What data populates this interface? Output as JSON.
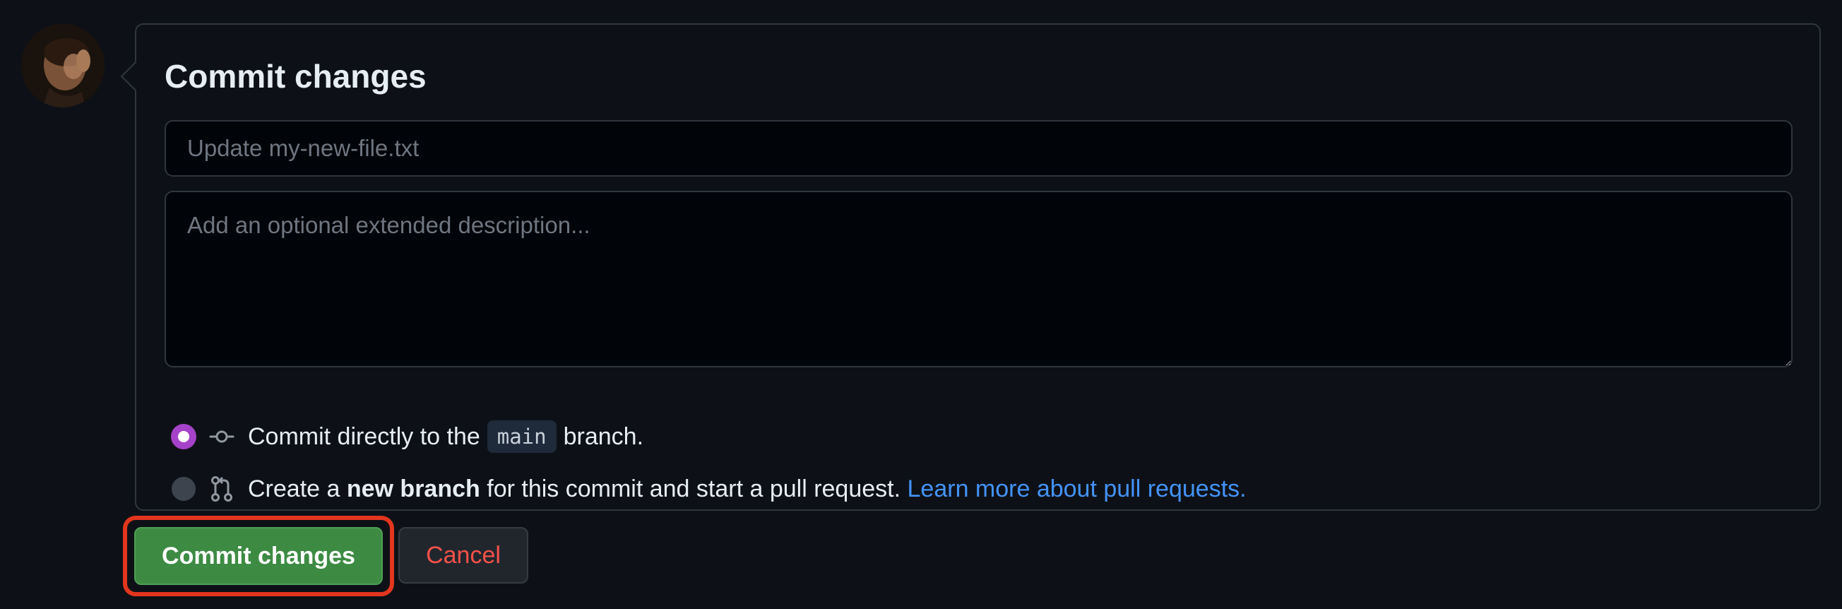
{
  "commit_form": {
    "title": "Commit changes",
    "summary_placeholder": "Update my-new-file.txt",
    "summary_value": "",
    "description_placeholder": "Add an optional extended description...",
    "description_value": "",
    "options": {
      "direct": {
        "text_before": "Commit directly to the",
        "branch": "main",
        "text_after": "branch.",
        "selected": true,
        "icon": "git-commit-icon"
      },
      "new_branch": {
        "text_before": "Create a",
        "bold": "new branch",
        "text_after": "for this commit and start a pull request.",
        "link": "Learn more about pull requests.",
        "selected": false,
        "icon": "git-pull-request-icon"
      }
    }
  },
  "actions": {
    "commit_label": "Commit changes",
    "cancel_label": "Cancel"
  },
  "colors": {
    "background": "#0d1117",
    "primary_button": "#3d8b43",
    "cancel_text": "#f85149",
    "link": "#4493f8",
    "radio_selected": "#a642c9",
    "highlight_outline": "#e2361f"
  }
}
